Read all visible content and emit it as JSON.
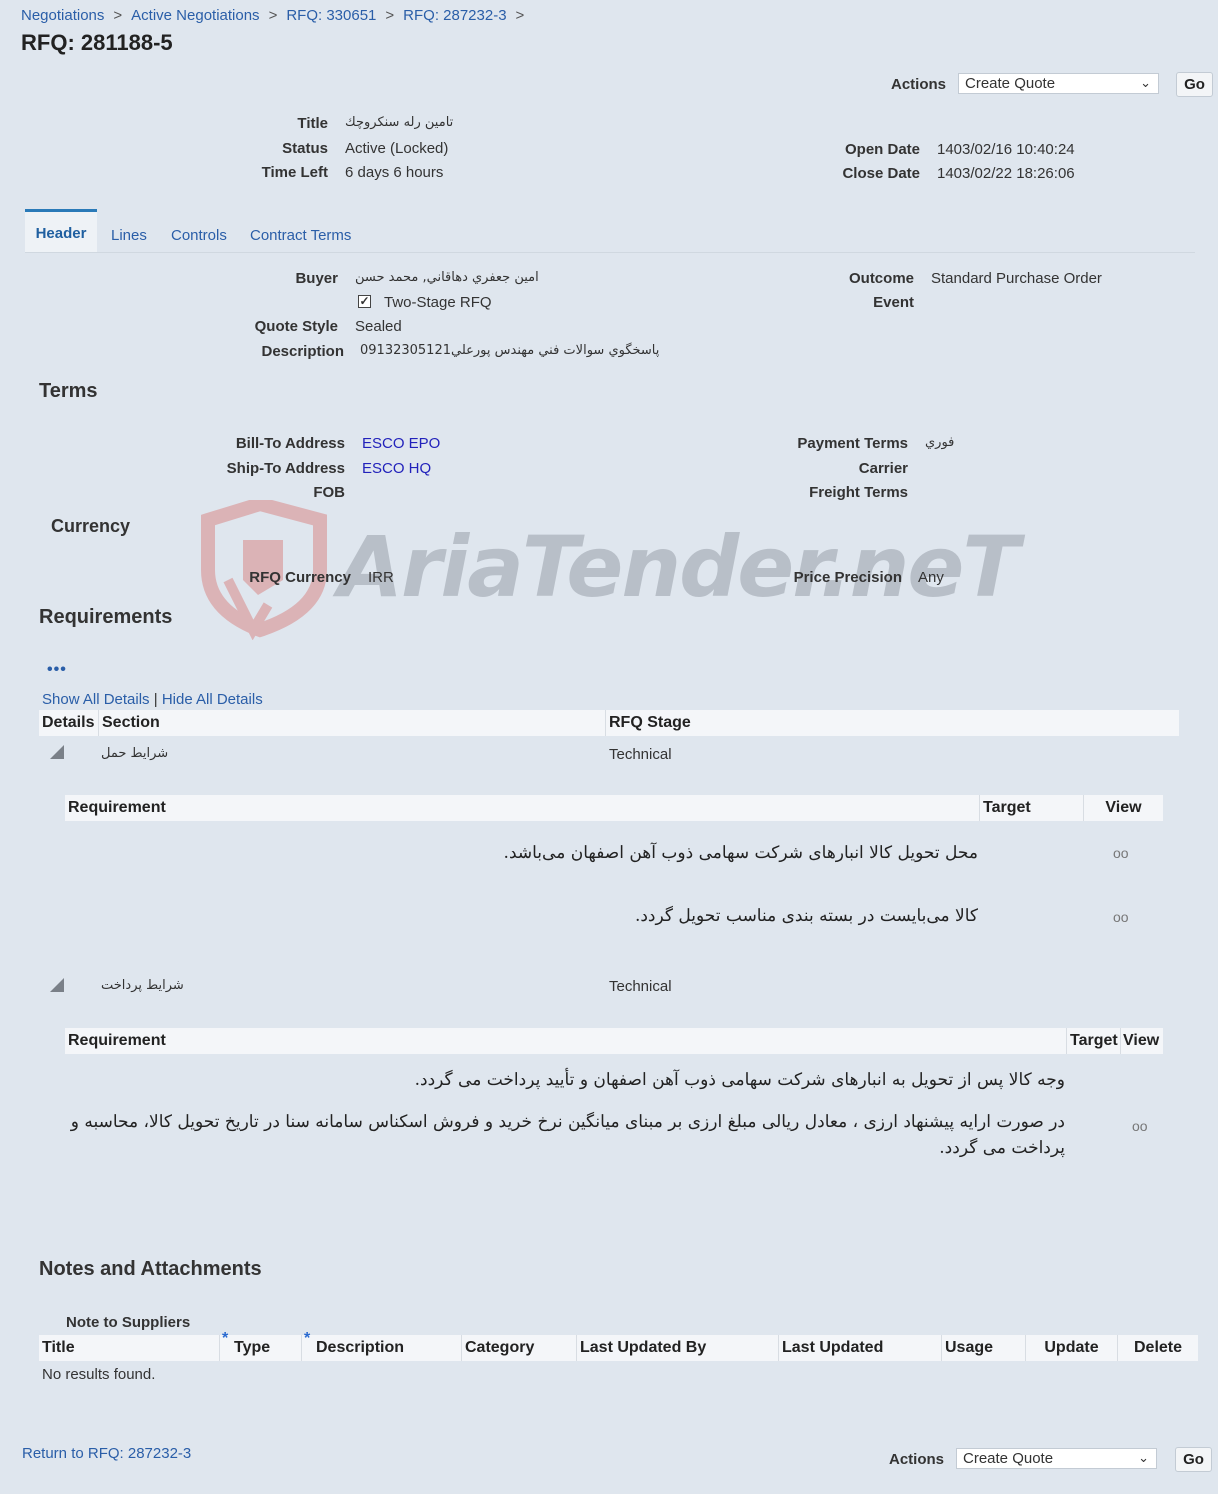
{
  "breadcrumb": [
    "Negotiations",
    "Active Negotiations",
    "RFQ: 330651",
    "RFQ: 287232-3"
  ],
  "breadcrumb_separator": ">",
  "page_title": "RFQ: 281188-5",
  "actions": {
    "label": "Actions",
    "selected": "Create Quote",
    "go_label": "Go"
  },
  "summary": {
    "title_label": "Title",
    "title_value": "تامين رله سنكروچك",
    "status_label": "Status",
    "status_value": "Active (Locked)",
    "time_left_label": "Time Left",
    "time_left_value": "6 days 6 hours",
    "open_date_label": "Open Date",
    "open_date_value": "1403/02/16 10:40:24",
    "close_date_label": "Close Date",
    "close_date_value": "1403/02/22 18:26:06"
  },
  "tabs": [
    "Header",
    "Lines",
    "Controls",
    "Contract Terms"
  ],
  "header": {
    "buyer_label": "Buyer",
    "buyer_value": "امين جعفري دهاقاني, محمد حسن",
    "two_stage_label": "Two-Stage RFQ",
    "two_stage_checked": true,
    "quote_style_label": "Quote Style",
    "quote_style_value": "Sealed",
    "description_label": "Description",
    "description_value": "پاسخگوي سوالات فني مهندس پورعلي09132305121",
    "outcome_label": "Outcome",
    "outcome_value": "Standard Purchase Order",
    "event_label": "Event"
  },
  "terms": {
    "heading": "Terms",
    "bill_to_label": "Bill-To Address",
    "bill_to_value": "ESCO EPO",
    "ship_to_label": "Ship-To Address",
    "ship_to_value": "ESCO HQ",
    "fob_label": "FOB",
    "payment_terms_label": "Payment Terms",
    "payment_terms_value": "فوري",
    "carrier_label": "Carrier",
    "freight_terms_label": "Freight Terms"
  },
  "currency": {
    "heading": "Currency",
    "rfq_currency_label": "RFQ Currency",
    "rfq_currency_value": "IRR",
    "price_precision_label": "Price Precision",
    "price_precision_value": "Any"
  },
  "watermark": "AriaTender.neT",
  "requirements": {
    "heading": "Requirements",
    "more_icon": "•••",
    "show_all": "Show All Details",
    "hide_all": "Hide All Details",
    "divider": "|",
    "columns": {
      "details": "Details",
      "section": "Section",
      "stage": "RFQ Stage"
    },
    "sub_columns": {
      "requirement": "Requirement",
      "target": "Target",
      "view": "View"
    },
    "view_icon": "oo",
    "sections": [
      {
        "name": "شرایط حمل",
        "stage": "Technical",
        "items": [
          "محل تحویل کالا انبارهای شرکت سهامی ذوب آهن اصفهان می‌باشد.",
          "کالا می‌بایست در بسته بندی مناسب تحویل گردد."
        ]
      },
      {
        "name": "شرایط پرداخت",
        "stage": "Technical",
        "items": [
          "وجه کالا پس از تحویل به انبارهای شرکت سهامی ذوب آهن اصفهان و تأیید پرداخت می گردد.",
          "در صورت ارایه پیشنهاد ارزی ، معادل ریالی مبلغ ارزی بر مبنای میانگین نرخ خرید و فروش اسکناس سامانه سنا در تاریخ تحویل کالا، محاسبه و",
          "پرداخت می گردد."
        ]
      }
    ]
  },
  "notes": {
    "heading": "Notes and Attachments",
    "note_to_suppliers": "Note to Suppliers",
    "required_mark": "*",
    "columns": [
      "Title",
      "Type",
      "Description",
      "Category",
      "Last Updated By",
      "Last Updated",
      "Usage",
      "Update",
      "Delete"
    ],
    "empty_text": "No results found."
  },
  "footer": {
    "return_link": "Return to RFQ: 287232-3"
  }
}
